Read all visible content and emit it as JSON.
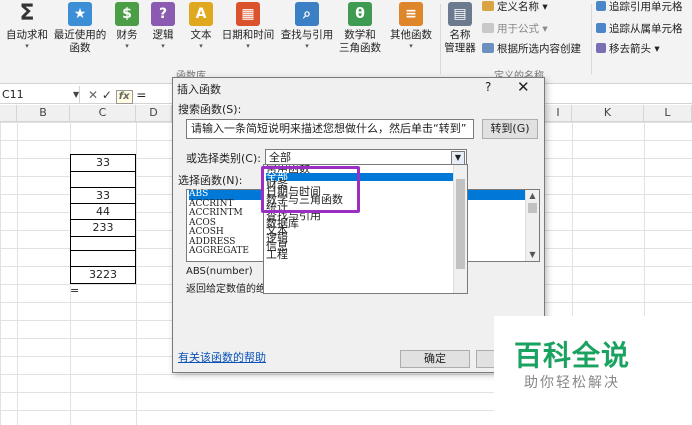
{
  "ribbon": {
    "buttons": [
      {
        "label": "自动求和",
        "icon": "sigma-icon",
        "color": "#333333",
        "glyph": "Σ"
      },
      {
        "label": "最近使用的\n函数",
        "icon": "book-star-icon",
        "color": "#3c8fd6",
        "glyph": "★"
      },
      {
        "label": "财务",
        "icon": "book-finance-icon",
        "color": "#4b9d46",
        "glyph": "$"
      },
      {
        "label": "逻辑",
        "icon": "book-logic-icon",
        "color": "#8a5bb0",
        "glyph": "?"
      },
      {
        "label": "文本",
        "icon": "book-text-icon",
        "color": "#e0a81f",
        "glyph": "A"
      },
      {
        "label": "日期和时间",
        "icon": "book-calendar-icon",
        "color": "#d9532c",
        "glyph": "▦"
      },
      {
        "label": "查找与引用",
        "icon": "book-search-icon",
        "color": "#3b7fc4",
        "glyph": "⌕"
      },
      {
        "label": "数学和\n三角函数",
        "icon": "book-math-icon",
        "color": "#3f9a52",
        "glyph": "θ"
      },
      {
        "label": "其他函数",
        "icon": "books-more-icon",
        "color": "#e0862a",
        "glyph": "≡"
      }
    ],
    "library_group": "函数库",
    "name_manager": "名称\n管理器",
    "define_name": "定义名称",
    "use_in_formula": "用于公式",
    "create_from_selection": "根据所选内容创建",
    "defined_names_group": "定义的名称",
    "trace_precedents": "追踪引用单元格",
    "trace_dependents": "追踪从属单元格",
    "remove_arrows": "移去箭头"
  },
  "formula_bar": {
    "name_box": "C11",
    "fx": "fx",
    "eq": "="
  },
  "columns": [
    "B",
    "C",
    "D",
    "H",
    "I",
    "K",
    "L"
  ],
  "cells": {
    "c1": "33",
    "c2": "33",
    "c3": "44",
    "c4": "233",
    "c5": "3223",
    "eq": "="
  },
  "dialog": {
    "title": "插入函数",
    "help": "?",
    "close": "✕",
    "search_label": "搜索函数(S):",
    "search_value": "请输入一条简短说明来描述您想做什么，然后单击“转到”",
    "go_button": "转到(G)",
    "category_label": "或选择类别(C):",
    "category_value": "全部",
    "select_function_label": "选择函数(N):",
    "functions": [
      "ABS",
      "ACCRINT",
      "ACCRINTM",
      "ACOS",
      "ACOSH",
      "ADDRESS",
      "AGGREGATE"
    ],
    "signature": "ABS(number)",
    "description": "返回给定数值的绝",
    "categories": [
      "常用函数",
      "全部",
      "财务",
      "日期与时间",
      "数学与三角函数",
      "统计",
      "查找与引用",
      "数据库",
      "文本",
      "逻辑",
      "信息",
      "工程"
    ],
    "help_link": "有关该函数的帮助",
    "ok_button": "确定"
  },
  "watermark": {
    "main": "百科全说",
    "sub": "助你轻松解决"
  }
}
